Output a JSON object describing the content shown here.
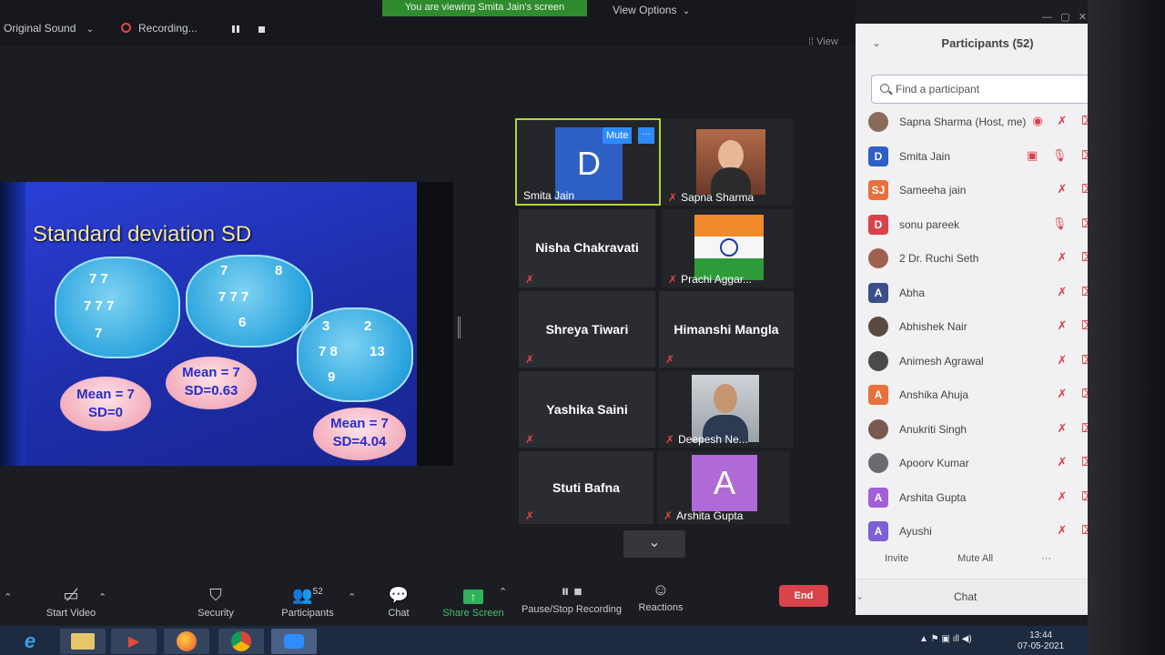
{
  "topbar": {
    "original_sound": "Original Sound",
    "recording": "Recording...",
    "viewing_banner": "You are viewing Smita Jain's screen",
    "view_options": "View Options",
    "view_button": "View"
  },
  "slide": {
    "title": "Standard deviation SD",
    "clouds": [
      {
        "lines": [
          "7  7",
          "7 7 7",
          "7"
        ]
      },
      {
        "lines": [
          "7",
          "8",
          "7 7 7",
          "6"
        ]
      },
      {
        "lines": [
          "3",
          "2",
          "7  8",
          "13",
          "9"
        ]
      }
    ],
    "ovals": [
      {
        "mean": "Mean = 7",
        "sd": "SD=0"
      },
      {
        "mean": "Mean = 7",
        "sd": "SD=0.63"
      },
      {
        "mean": "Mean = 7",
        "sd": "SD=4.04"
      }
    ]
  },
  "videos": {
    "smita": {
      "name": "Smita Jain",
      "initial": "D",
      "mute": "Mute",
      "more": "···"
    },
    "sapna": {
      "name": "Sapna Sharma"
    },
    "nisha": {
      "name": "Nisha Chakravati"
    },
    "prachi": {
      "name": "Prachi Aggar..."
    },
    "shreya": {
      "name": "Shreya Tiwari"
    },
    "himanshi": {
      "name": "Himanshi Mangla"
    },
    "yashika": {
      "name": "Yashika Saini"
    },
    "deepesh": {
      "name": "Deepesh Ne..."
    },
    "stuti": {
      "name": "Stuti Bafna"
    },
    "arshita": {
      "name": "Arshita Gupta",
      "initial": "A"
    }
  },
  "participants": {
    "header": "Participants (52)",
    "search_placeholder": "Find a participant",
    "list": [
      {
        "name": "Sapna Sharma (Host, me)",
        "initial": "",
        "color": "#8a6a5a"
      },
      {
        "name": "Smita Jain",
        "initial": "D",
        "color": "#2d5fc4"
      },
      {
        "name": "Sameeha jain",
        "initial": "SJ",
        "color": "#e8703a"
      },
      {
        "name": "sonu pareek",
        "initial": "D",
        "color": "#d9414b"
      },
      {
        "name": "2 Dr. Ruchi Seth",
        "initial": "",
        "color": "#a06050"
      },
      {
        "name": "Abha",
        "initial": "A",
        "color": "#3a4f8a"
      },
      {
        "name": "Abhishek Nair",
        "initial": "",
        "color": "#5a4a40"
      },
      {
        "name": "Animesh Agrawal",
        "initial": "",
        "color": "#4a4a4a"
      },
      {
        "name": "Anshika Ahuja",
        "initial": "A",
        "color": "#e8703a"
      },
      {
        "name": "Anukriti Singh",
        "initial": "",
        "color": "#7a5a50"
      },
      {
        "name": "Apoorv Kumar",
        "initial": "",
        "color": "#6a6a70"
      },
      {
        "name": "Arshita Gupta",
        "initial": "A",
        "color": "#a35fd6"
      },
      {
        "name": "Ayushi",
        "initial": "A",
        "color": "#7d5fd6"
      }
    ],
    "invite": "Invite",
    "mute_all": "Mute All",
    "more": "···",
    "chat": "Chat"
  },
  "toolbar": {
    "start_video": "Start Video",
    "security": "Security",
    "participants": "Participants",
    "participants_count": "52",
    "chat": "Chat",
    "share_screen": "Share Screen",
    "pause_stop_recording": "Pause/Stop Recording",
    "reactions": "Reactions",
    "end": "End"
  },
  "taskbar": {
    "time": "13:44",
    "date": "07-05-2021"
  }
}
